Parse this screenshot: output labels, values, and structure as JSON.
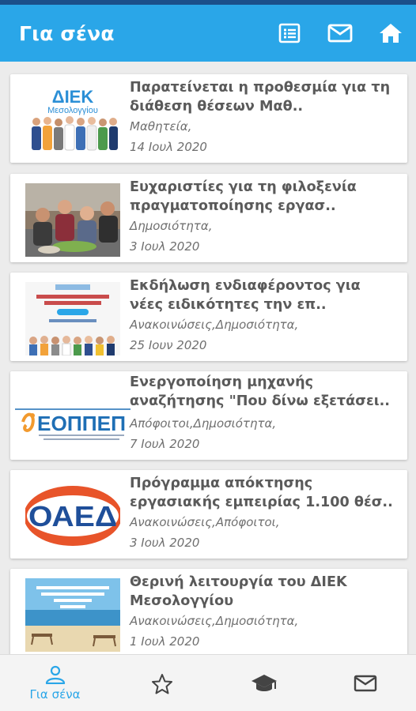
{
  "colors": {
    "accent": "#2aa6e8",
    "status_bar": "#1b4f8a",
    "title_text": "#5a5a5a",
    "meta_text": "#6f6f6f"
  },
  "appbar": {
    "title": "Για σένα",
    "actions": [
      {
        "icon": "list-icon"
      },
      {
        "icon": "mail-icon"
      },
      {
        "icon": "home-icon"
      }
    ]
  },
  "thumbnail_text": {
    "diek_logo": "ΔΙΕΚ",
    "diek_sub": "Μεσολογγίου",
    "eoppep": "ΕΟΠΠΕΠ",
    "oaed": "ΟΑΕΔ"
  },
  "feed": {
    "items": [
      {
        "title": "Παρατείνεται η προθεσμία για τη\nδιάθεση θέσεων Μαθ..",
        "categories": "Μαθητεία,",
        "date": "14 Ιουλ 2020",
        "image": "diek-group"
      },
      {
        "title": "Ευχαριστίες για τη φιλοξενία\nπραγματοποίησης εργασ..",
        "categories": "Δημοσιότητα,",
        "date": "3 Ιουλ 2020",
        "image": "cooking"
      },
      {
        "title": "Εκδήλωση ενδιαφέροντος για\nνέες ειδικότητες την επ..",
        "categories": "Ανακοινώσεις,Δημοσιότητα,",
        "date": "25 Ιουν 2020",
        "image": "diek-poster"
      },
      {
        "title": "Ενεργοποίηση μηχανής\nαναζήτησης \"Που δίνω εξετάσει..",
        "categories": "Απόφοιτοι,Δημοσιότητα,",
        "date": "7 Ιουλ 2020",
        "image": "eoppep-logo"
      },
      {
        "title": "Πρόγραμμα απόκτησης\nεργασιακής εμπειρίας 1.100 θέσ..",
        "categories": "Ανακοινώσεις,Απόφοιτοι,",
        "date": "3 Ιουλ 2020",
        "image": "oaed-logo"
      },
      {
        "title": "Θερινή λειτουργία του ΔΙΕΚ\nΜεσολογγίου",
        "categories": "Ανακοινώσεις,Δημοσιότητα,",
        "date": "1 Ιουλ 2020",
        "image": "beach"
      }
    ]
  },
  "bottom_nav": {
    "items": [
      {
        "icon": "person-icon",
        "label": "Για σένα",
        "active": true
      },
      {
        "icon": "star-icon",
        "label": "",
        "active": false
      },
      {
        "icon": "graduation-cap-icon",
        "label": "",
        "active": false
      },
      {
        "icon": "mail-icon",
        "label": "",
        "active": false
      }
    ]
  }
}
